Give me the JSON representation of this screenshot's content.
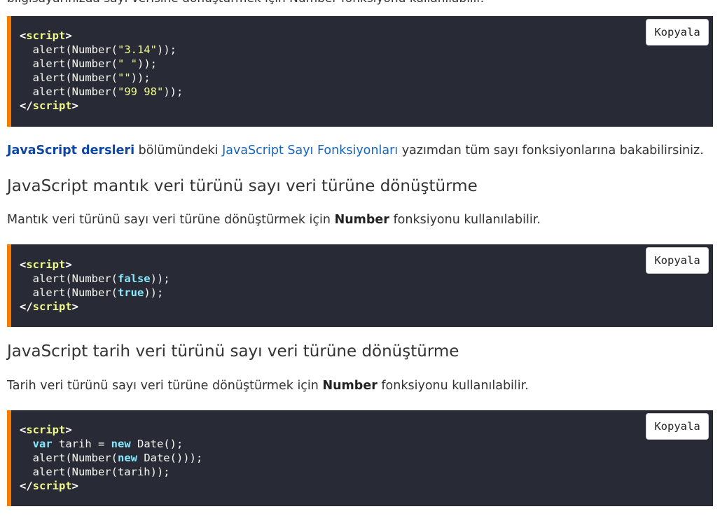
{
  "partial_top_text": "bilgisayarınızda sayı verisine dönüştürmek için Number fonksiyonu kullanılabilir.",
  "copy_label": "Kopyala",
  "code_blocks": [
    {
      "lines": [
        [
          "<",
          "script",
          ">"
        ],
        [
          "  alert(Number(",
          "\"3.14\"",
          "));"
        ],
        [
          "  alert(Number(",
          "\" \"",
          "));"
        ],
        [
          "  alert(Number(",
          "\"\"",
          "));"
        ],
        [
          "  alert(Number(",
          "\"99 98\"",
          "));"
        ],
        [
          "</",
          "script",
          ">"
        ]
      ]
    },
    {
      "lines": [
        [
          "<",
          "script",
          ">"
        ],
        [
          "  alert(Number(",
          "false",
          "));"
        ],
        [
          "  alert(Number(",
          "true",
          "));"
        ],
        [
          "</",
          "script",
          ">"
        ]
      ]
    },
    {
      "lines": [
        [
          "<",
          "script",
          ">"
        ],
        [
          "  ",
          "var",
          " tarih = ",
          "new",
          " Date();"
        ],
        [
          "  alert(Number(",
          "new",
          " Date()));"
        ],
        [
          "  alert(Number(tarih));"
        ],
        [
          "</",
          "script",
          ">"
        ]
      ]
    }
  ],
  "para1": {
    "link1": "JavaScript dersleri",
    "text1": " bölümündeki ",
    "link2": "JavaScript Sayı Fonksiyonları",
    "text2": " yazımdan tüm sayı fonksiyonlarına bakabilirsiniz."
  },
  "heading1": "JavaScript mantık veri türünü sayı veri türüne dönüştürme",
  "para2": {
    "text1": "Mantık veri türünü sayı veri türüne dönüştürmek için ",
    "bold": "Number",
    "text2": " fonksiyonu kullanılabilir."
  },
  "heading2": "JavaScript tarih veri türünü sayı veri türüne dönüştürme",
  "para3": {
    "text1": "Tarih veri türünü sayı veri türüne dönüştürmek için ",
    "bold": "Number",
    "text2": " fonksiyonu kullanılabilir."
  }
}
